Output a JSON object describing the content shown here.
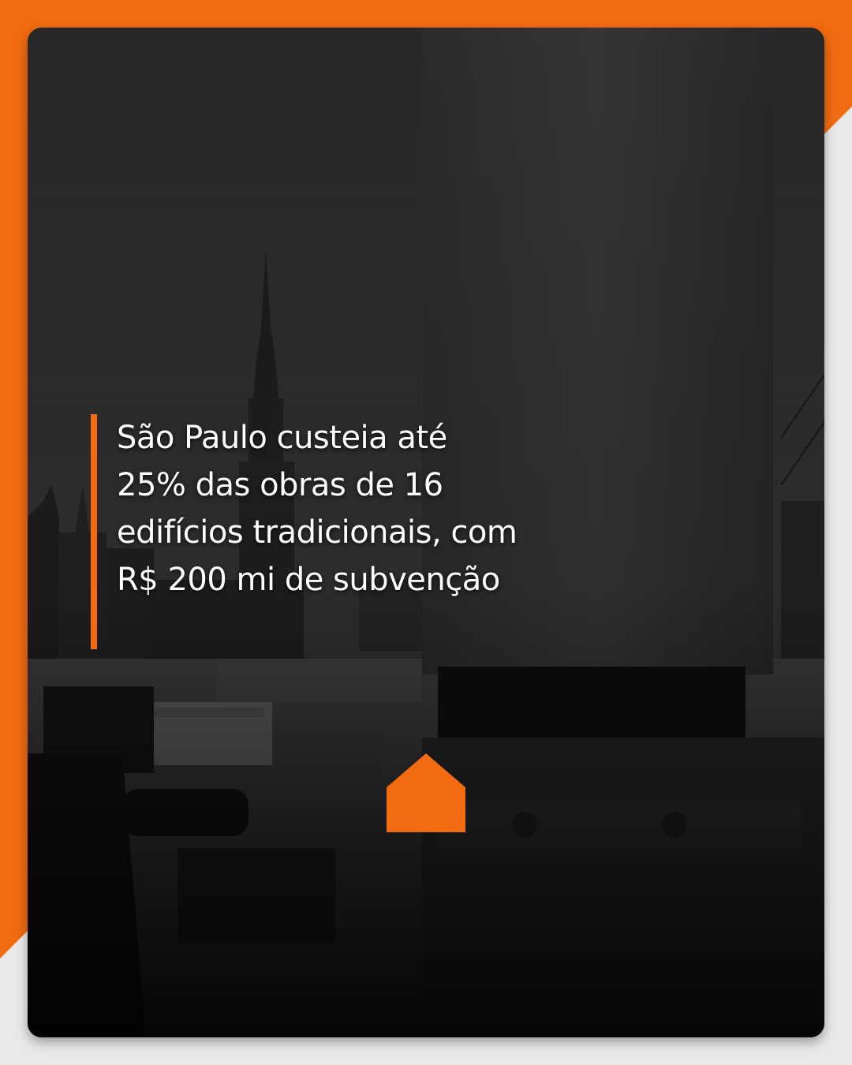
{
  "colors": {
    "brand_orange": "#f26b10",
    "page_background": "#e9e9e9",
    "text": "#ffffff"
  },
  "post": {
    "headline": "São Paulo custeia até 25% das obras de 16 edifícios tradicionais, com R$ 200 mi de subvenção"
  },
  "icons": {
    "brand_logo": "house-icon"
  }
}
